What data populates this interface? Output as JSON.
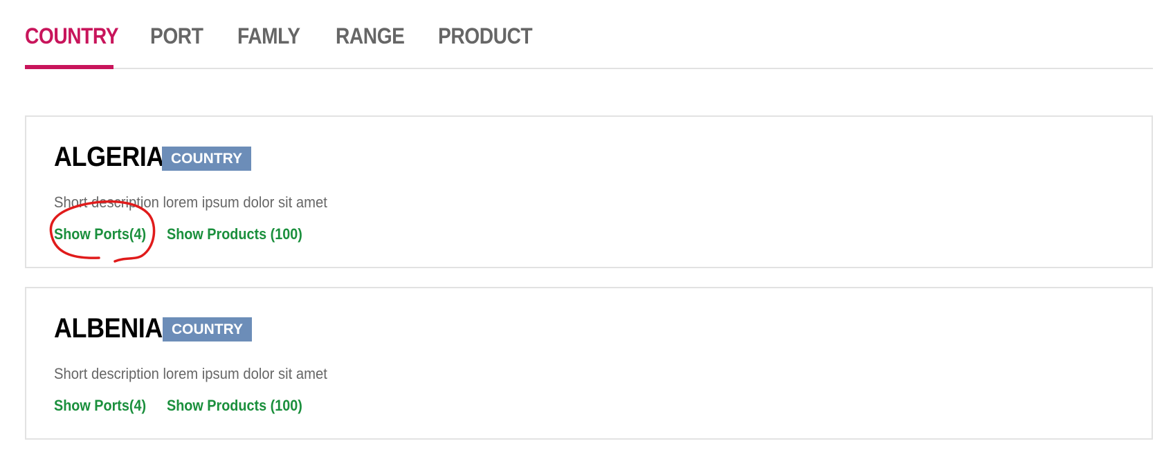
{
  "tabs": [
    {
      "label": "COUNTRY",
      "active": true
    },
    {
      "label": "PORT",
      "active": false
    },
    {
      "label": "FAMLY",
      "active": false
    },
    {
      "label": "RANGE",
      "active": false
    },
    {
      "label": "PRODUCT",
      "active": false
    }
  ],
  "cards": [
    {
      "title": "ALGERIA",
      "badge": "COUNTRY",
      "description": "Short description lorem ipsum dolor sit amet",
      "ports_link": "Show Ports(4)",
      "products_link": "Show Products (100)"
    },
    {
      "title": "ALBENIA",
      "badge": "COUNTRY",
      "description": "Short description lorem ipsum dolor sit amet",
      "ports_link": "Show Ports(4)",
      "products_link": "Show Products (100)"
    }
  ],
  "colors": {
    "accent": "#c8155b",
    "badge": "#6c8db8",
    "link": "#1a8f3c",
    "annotation": "#e01b1b"
  }
}
